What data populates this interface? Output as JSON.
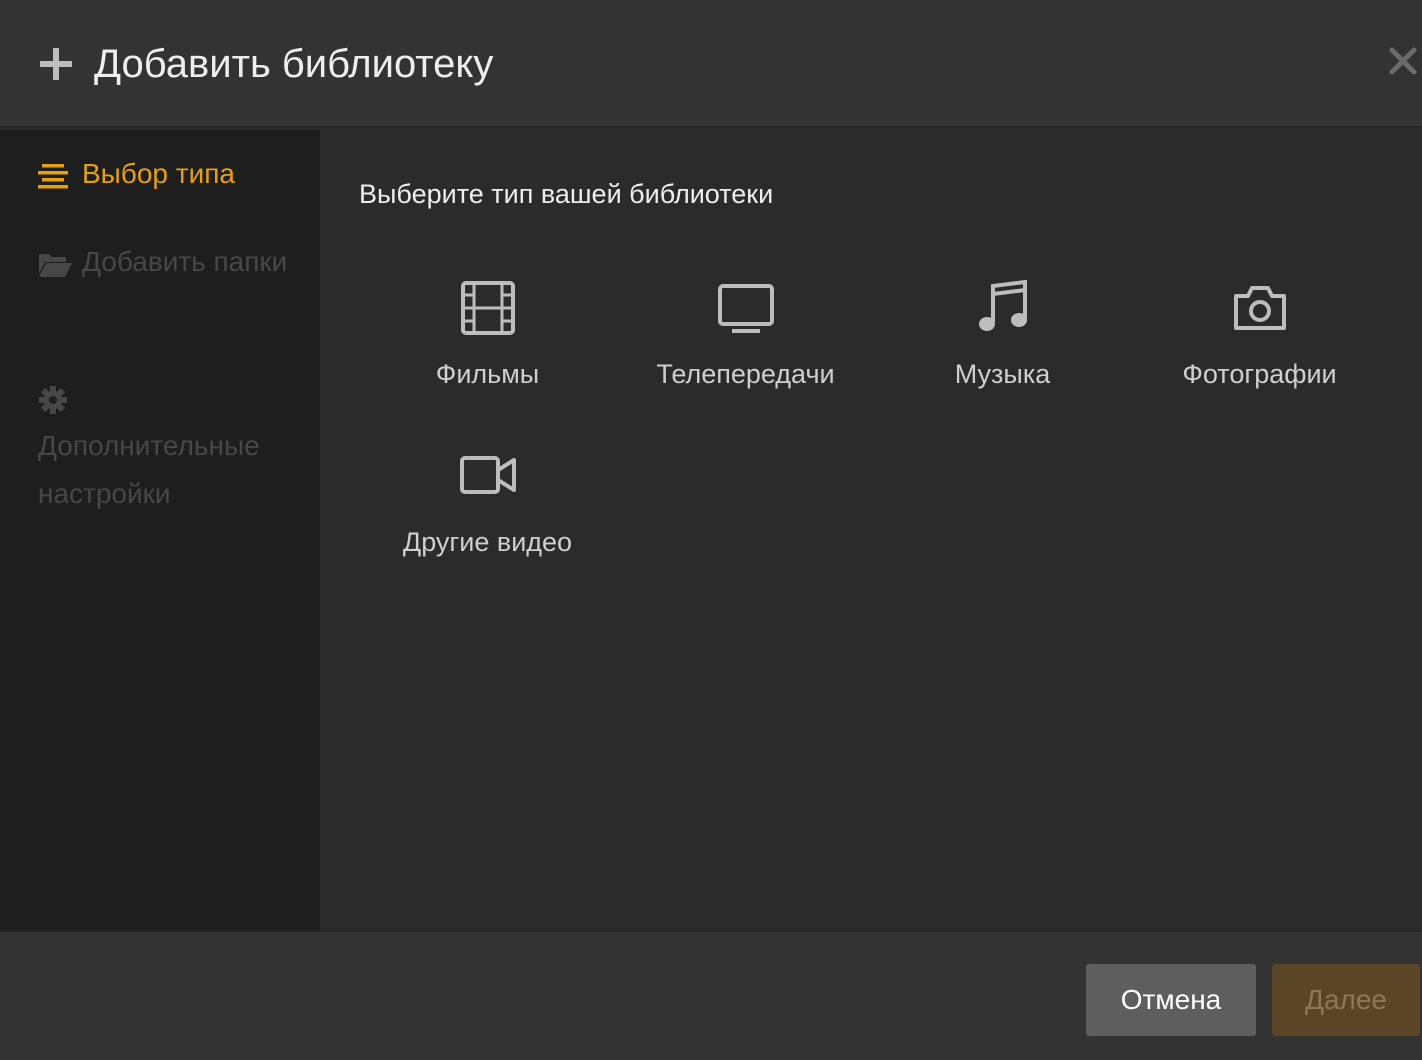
{
  "header": {
    "title": "Добавить библиотеку",
    "plus_icon": "plus-icon",
    "close_icon": "close-icon"
  },
  "sidebar": {
    "steps": [
      {
        "label": "Выбор типа",
        "icon": "list-icon",
        "state": "active"
      },
      {
        "label": "Добавить папки",
        "icon": "folder-open-icon",
        "state": "disabled"
      },
      {
        "label": "Дополнительные настройки",
        "icon": "gear-icon",
        "state": "disabled"
      }
    ]
  },
  "main": {
    "heading": "Выберите тип вашей библиотеки",
    "types": [
      {
        "label": "Фильмы",
        "icon": "film-icon"
      },
      {
        "label": "Телепередачи",
        "icon": "tv-icon"
      },
      {
        "label": "Музыка",
        "icon": "music-note-icon"
      },
      {
        "label": "Фотографии",
        "icon": "camera-icon"
      },
      {
        "label": "Другие видео",
        "icon": "video-camera-icon"
      }
    ]
  },
  "footer": {
    "cancel_label": "Отмена",
    "next_label": "Далее"
  },
  "colors": {
    "accent": "#e5a00d",
    "header_bg": "#333333",
    "sidebar_bg": "#1e1e1e",
    "main_bg": "#2b2b2b",
    "disabled_text": "#474747",
    "cancel_bg": "#5e5e5e",
    "next_bg_disabled": "#5a4526"
  }
}
